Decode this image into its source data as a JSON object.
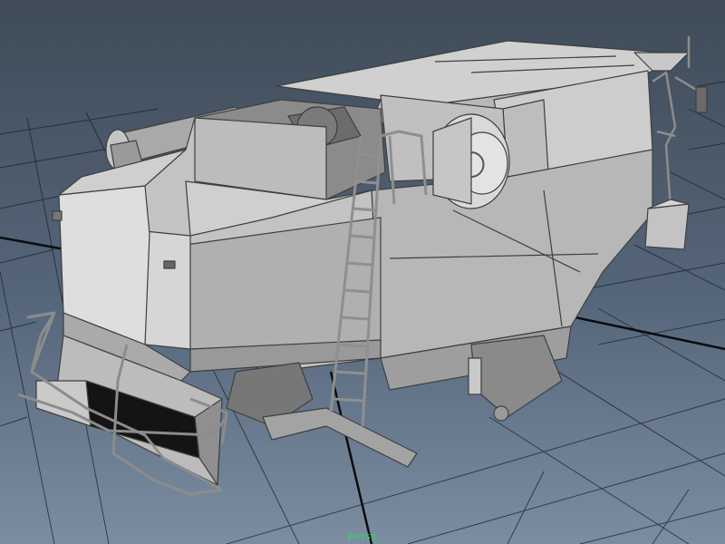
{
  "viewport": {
    "camera_name": "persp",
    "background_top": "#3f4b58",
    "background_bottom": "#7b8da1",
    "grid_color": "#1c2229",
    "grid_axis_color": "#0a0c0e"
  },
  "scene": {
    "object": "combine-harvester-model",
    "shading": "smooth-shaded-gray",
    "model_color": "#b5b5b5",
    "label_color": "#35d46a"
  }
}
